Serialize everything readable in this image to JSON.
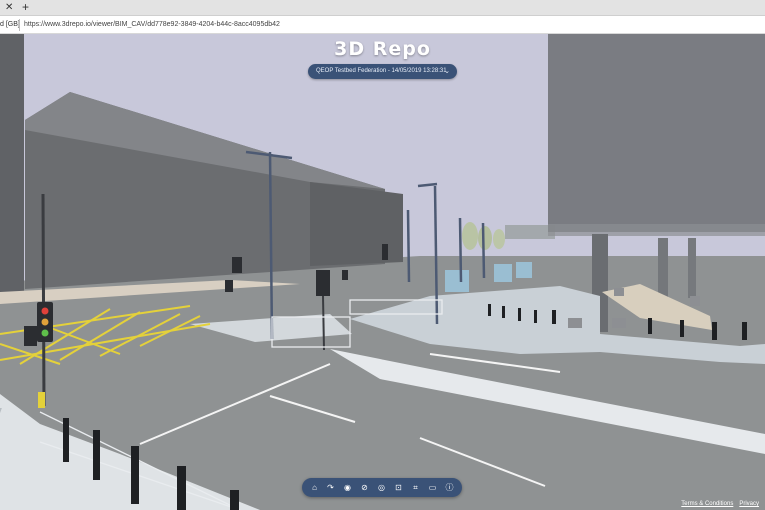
{
  "browser": {
    "tab_close_icon": "close-icon",
    "new_tab_label": "+",
    "cert_label": "d [GB]",
    "url": "https://www.3drepo.io/viewer/BIM_CAV/dd778e92-3849-4204-b44c-8acc4095db42"
  },
  "app": {
    "brand": "3D Repo",
    "model_selector": "QEOP Testbed Federation - 14/05/2019 13:28:31",
    "toolbar_icons": [
      "home-icon",
      "navigation-mode-icon",
      "show-all-icon",
      "hide-icon",
      "isolate-icon",
      "focus-icon",
      "clip-icon",
      "measure-icon",
      "info-icon"
    ],
    "footer": {
      "terms": "Terms & Conditions",
      "privacy": "Privacy"
    }
  },
  "colors": {
    "sky": "#c8c8d8",
    "accent_bar": "#3a5277",
    "road": "#8f9293",
    "pavement": "#cdd2d6",
    "building": "#6d6f72"
  }
}
